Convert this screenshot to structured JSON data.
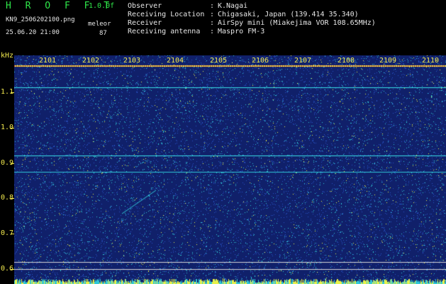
{
  "header": {
    "app_title": "H R O F F T",
    "version": "1.0.0f",
    "filename": "KN9_2506202100.png",
    "datetime": "25.06.20 21:00",
    "program_label": "meleor",
    "count": "87"
  },
  "meta": [
    {
      "key": "Observer",
      "value": "K.Nagai"
    },
    {
      "key": "Receiving Location",
      "value": "Chigasaki, Japan (139.414 35.340)"
    },
    {
      "key": "Receiver",
      "value": "AirSpy mini (Miakejima VOR 108.65MHz)"
    },
    {
      "key": "Receiving antenna",
      "value": "Maspro FM-3"
    }
  ],
  "meta_separator": ":",
  "spectrogram": {
    "y_unit": "kHz",
    "y_ticks": [
      "1.1",
      "1.0",
      "0.9",
      "0.8",
      "0.7",
      "0.6"
    ],
    "x_ticks": [
      "2101",
      "2102",
      "2103",
      "2104",
      "2105",
      "2106",
      "2107",
      "2108",
      "2109",
      "2110"
    ],
    "colors": {
      "background": "#10206a",
      "noise_low": "#2a55c8",
      "noise_mid": "#30c8d8",
      "noise_high": "#e8f24a",
      "carrier": "#38e0e8",
      "marker": "#e23030"
    }
  }
}
